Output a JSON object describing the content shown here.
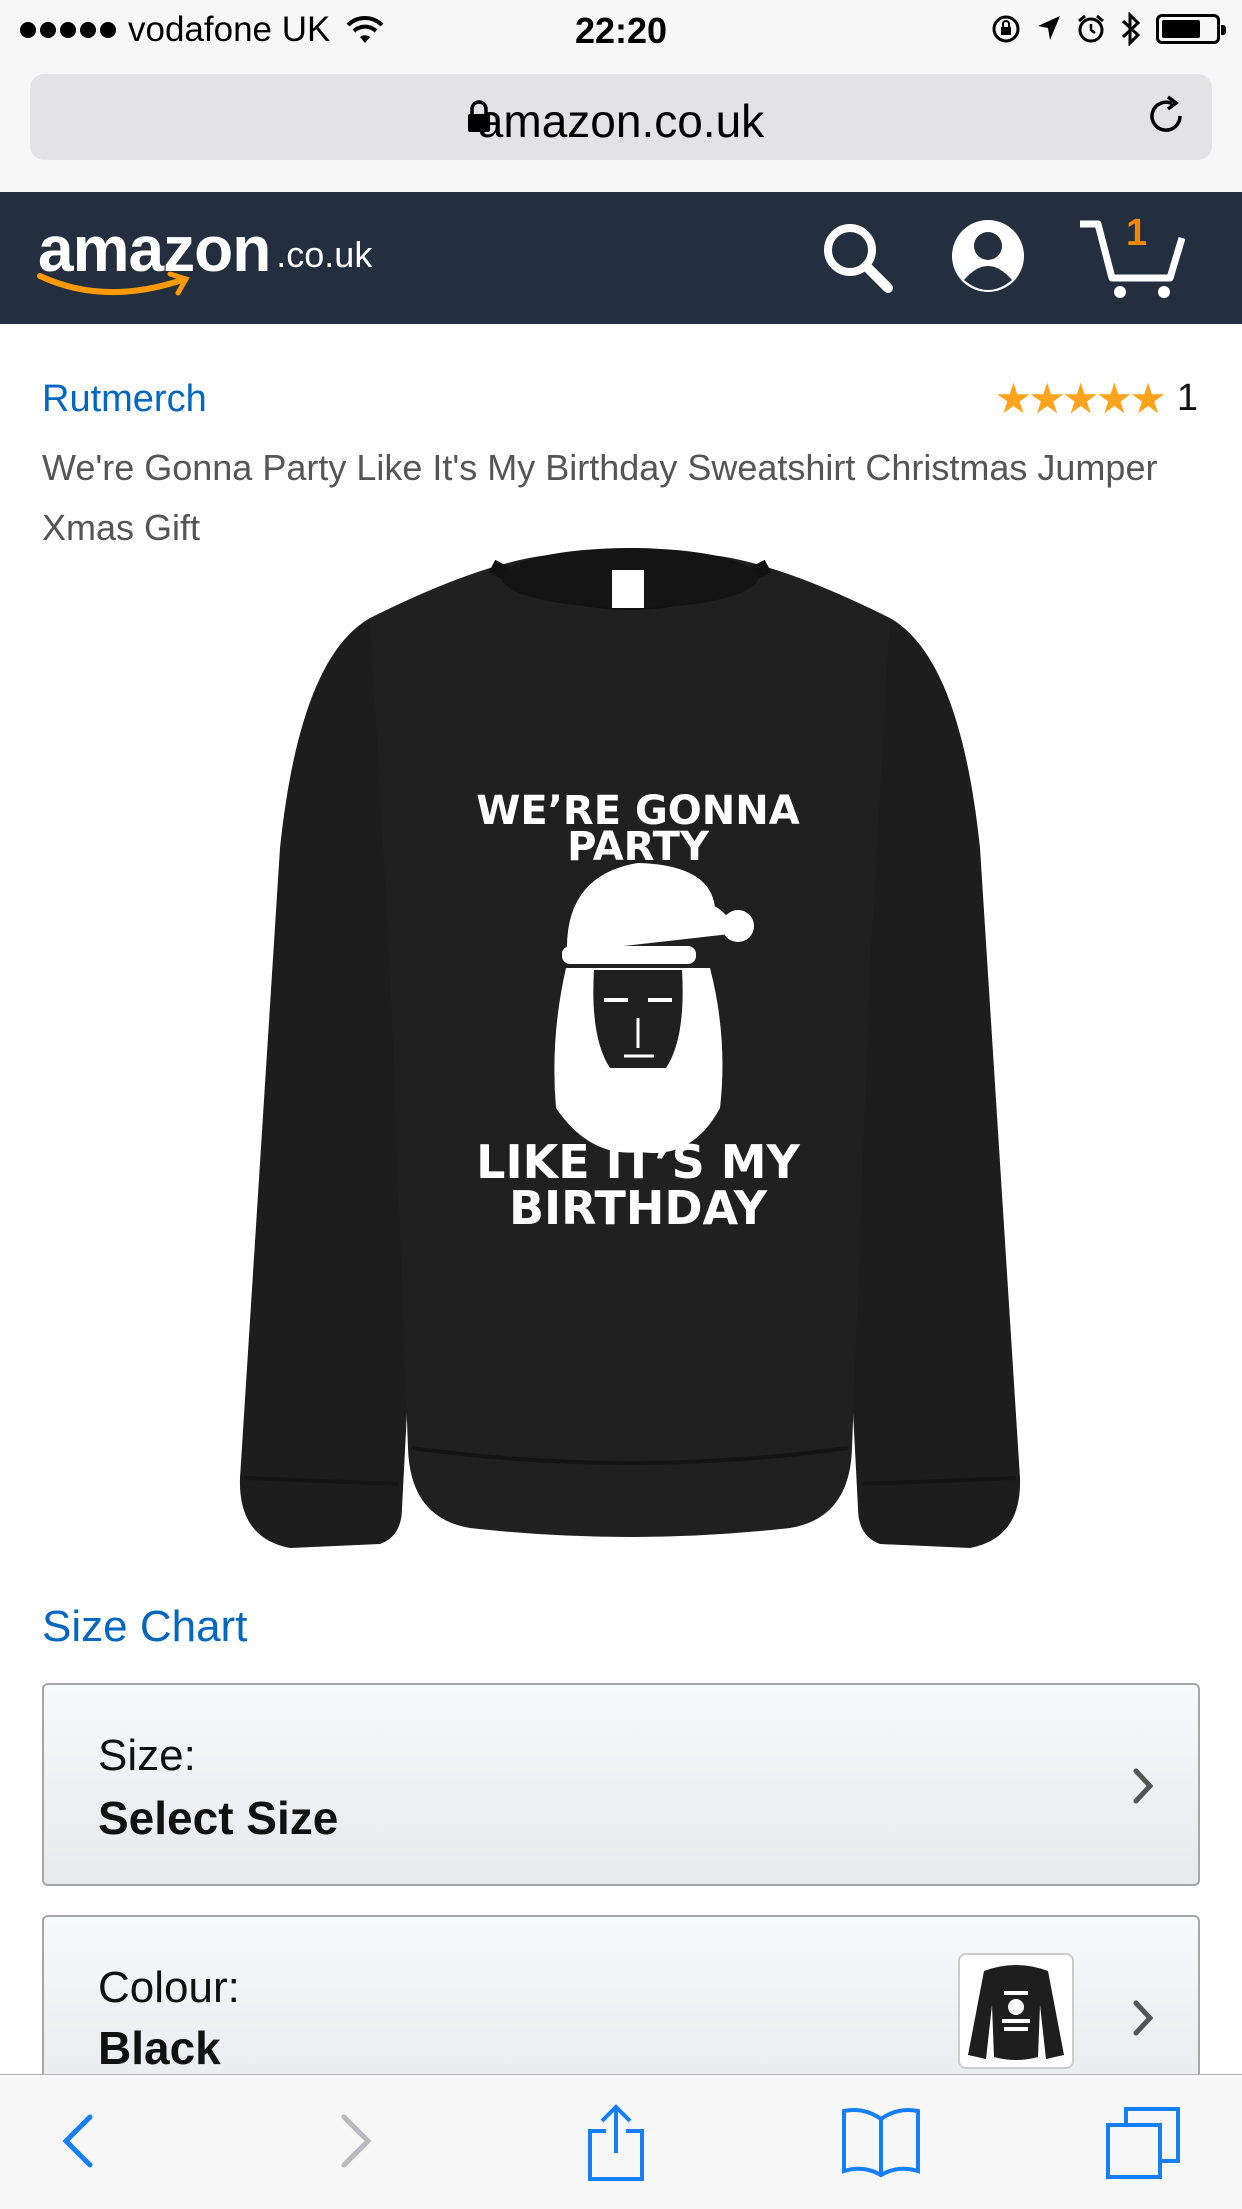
{
  "status_bar": {
    "carrier": "vodafone UK",
    "time": "22:20",
    "signal_bars": 5,
    "battery_level": 0.6
  },
  "browser": {
    "url": "amazon.co.uk"
  },
  "header": {
    "logo_word": "amazon",
    "logo_tld": ".co.uk",
    "cart_count": "1",
    "icons": [
      "search-icon",
      "account-icon",
      "cart-icon"
    ]
  },
  "product": {
    "brand": "Rutmerch",
    "rating_stars": "★★★★★",
    "rating_value": 5,
    "rating_count": "1",
    "title": "We're Gonna Party Like It's My Birthday Sweatshirt Christmas Jumper Xmas Gift",
    "image_text": {
      "line1": "WE’RE GONNA",
      "line2": "PARTY",
      "line3": "LIKE IT’S MY",
      "line4": "BIRTHDAY"
    }
  },
  "size_chart_label": "Size Chart",
  "size_select": {
    "label": "Size:",
    "value": "Select Size"
  },
  "colour_select": {
    "label": "Colour:",
    "value": "Black"
  },
  "toolbar": {
    "icons": [
      "back-icon",
      "forward-icon",
      "share-icon",
      "bookmarks-icon",
      "tabs-icon"
    ]
  },
  "colors": {
    "amazon_header": "#232f3e",
    "link": "#0066c0",
    "star": "#ffa41c",
    "cart_badge": "#f08804",
    "ios_blue": "#157efb"
  }
}
